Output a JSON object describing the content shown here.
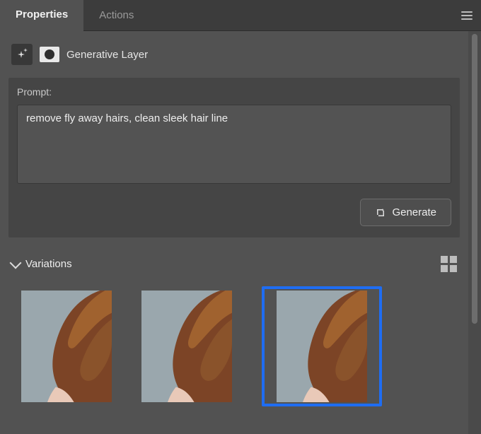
{
  "tabs": [
    {
      "label": "Properties",
      "active": true
    },
    {
      "label": "Actions",
      "active": false
    }
  ],
  "layer": {
    "title": "Generative Layer"
  },
  "prompt": {
    "label": "Prompt:",
    "value": "remove fly away hairs, clean sleek hair line"
  },
  "generate": {
    "label": "Generate"
  },
  "variations": {
    "title": "Variations",
    "items": [
      {
        "id": "variation-1",
        "selected": false
      },
      {
        "id": "variation-2",
        "selected": false
      },
      {
        "id": "variation-3",
        "selected": true
      }
    ]
  }
}
